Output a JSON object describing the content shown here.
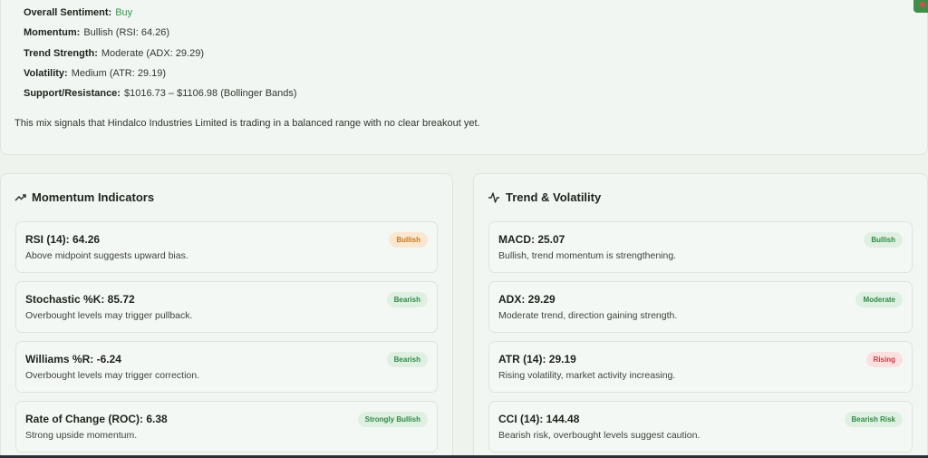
{
  "summary": {
    "rows": [
      {
        "key": "Overall Sentiment:",
        "value": "Buy"
      },
      {
        "key": "Momentum:",
        "value": "Bullish (RSI: 64.26)"
      },
      {
        "key": "Trend Strength:",
        "value": "Moderate (ADX: 29.29)"
      },
      {
        "key": "Volatility:",
        "value": "Medium (ATR: 29.19)"
      },
      {
        "key": "Support/Resistance:",
        "value": "$1016.73 – $1106.98 (Bollinger Bands)"
      }
    ],
    "note": "This mix signals that Hindalco Industries Limited is trading in a balanced range with no clear breakout yet."
  },
  "momentum": {
    "title": "Momentum Indicators",
    "icon": "trending-up-icon",
    "cards": [
      {
        "title": "RSI (14): 64.26",
        "desc": "Above midpoint suggests upward bias.",
        "badge": "Bullish",
        "badge_color": "#c4771f"
      },
      {
        "title": "Stochastic %K: 85.72",
        "desc": "Overbought levels may trigger pullback.",
        "badge": "Bearish",
        "badge_color": "#2f8a45"
      },
      {
        "title": "Williams %R: -6.24",
        "desc": "Overbought levels may trigger correction.",
        "badge": "Bearish",
        "badge_color": "#2f8a45"
      },
      {
        "title": "Rate of Change (ROC): 6.38",
        "desc": "Strong upside momentum.",
        "badge": "Strongly Bullish",
        "badge_color": "#2f8a45"
      }
    ]
  },
  "trend": {
    "title": "Trend & Volatility",
    "icon": "activity-icon",
    "cards": [
      {
        "title": "MACD: 25.07",
        "desc": "Bullish, trend momentum is strengthening.",
        "badge": "Bullish",
        "badge_color": "#2f8a45"
      },
      {
        "title": "ADX: 29.29",
        "desc": "Moderate trend, direction gaining strength.",
        "badge": "Moderate",
        "badge_color": "#2f8a45"
      },
      {
        "title": "ATR (14): 29.19",
        "desc": "Rising volatility, market activity increasing.",
        "badge": "Rising",
        "badge_color": "#d23a3a"
      },
      {
        "title": "CCI (14): 144.48",
        "desc": "Bearish risk, overbought levels suggest caution.",
        "badge": "Bearish Risk",
        "badge_color": "#2f8a45"
      }
    ]
  },
  "colors": {
    "accent_green": "#2f9a4a",
    "background": "#eef3ee"
  }
}
